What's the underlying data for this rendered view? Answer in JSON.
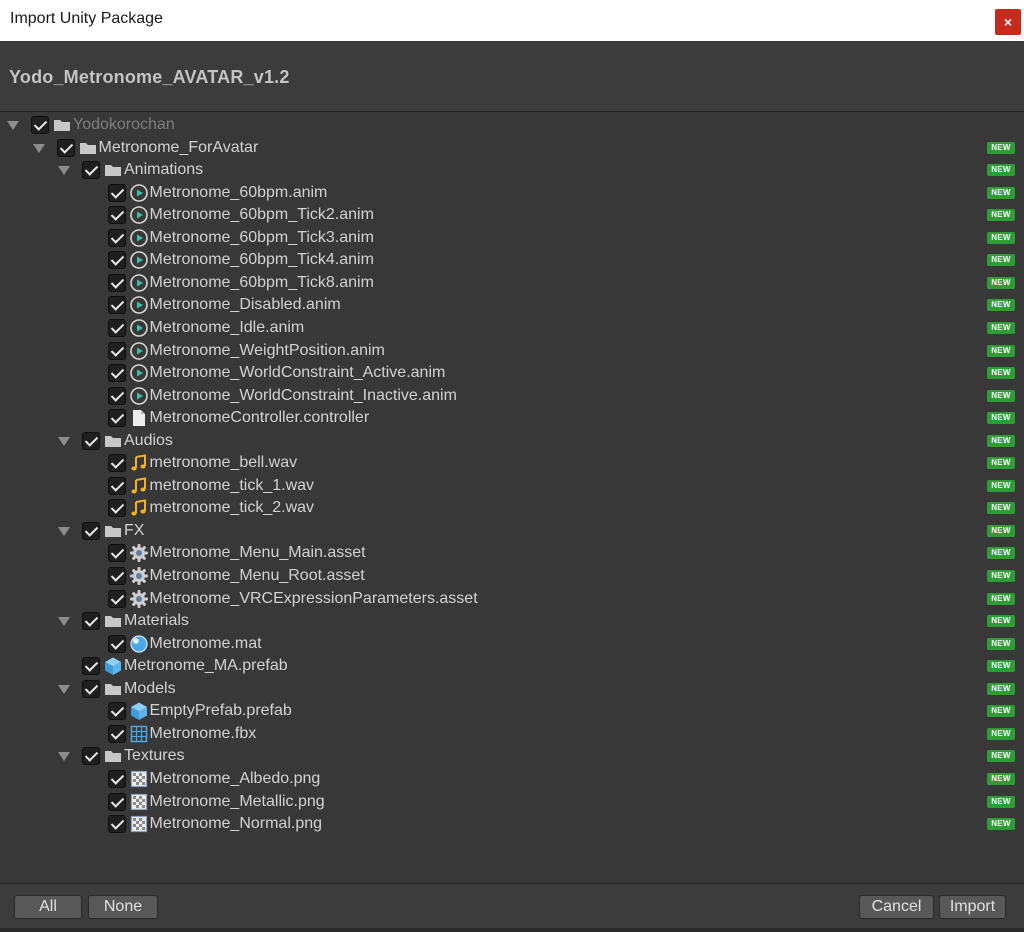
{
  "window": {
    "title": "Import Unity Package",
    "close_glyph": "×"
  },
  "package": {
    "name": "Yodo_Metronome_AVATAR_v1.2"
  },
  "badge_text": "NEW",
  "rows": [
    {
      "label": "Yodokorochan",
      "icon": "folder-icon",
      "depth": 0,
      "expandable": true,
      "dim": true,
      "new": false
    },
    {
      "label": "Metronome_ForAvatar",
      "icon": "folder-icon",
      "depth": 1,
      "expandable": true,
      "new": true
    },
    {
      "label": "Animations",
      "icon": "folder-icon",
      "depth": 2,
      "expandable": true,
      "new": true
    },
    {
      "label": "Metronome_60bpm.anim",
      "icon": "animation-clip-icon",
      "depth": 3,
      "new": true
    },
    {
      "label": "Metronome_60bpm_Tick2.anim",
      "icon": "animation-clip-icon",
      "depth": 3,
      "new": true
    },
    {
      "label": "Metronome_60bpm_Tick3.anim",
      "icon": "animation-clip-icon",
      "depth": 3,
      "new": true
    },
    {
      "label": "Metronome_60bpm_Tick4.anim",
      "icon": "animation-clip-icon",
      "depth": 3,
      "new": true
    },
    {
      "label": "Metronome_60bpm_Tick8.anim",
      "icon": "animation-clip-icon",
      "depth": 3,
      "new": true
    },
    {
      "label": "Metronome_Disabled.anim",
      "icon": "animation-clip-icon",
      "depth": 3,
      "new": true
    },
    {
      "label": "Metronome_Idle.anim",
      "icon": "animation-clip-icon",
      "depth": 3,
      "new": true
    },
    {
      "label": "Metronome_WeightPosition.anim",
      "icon": "animation-clip-icon",
      "depth": 3,
      "new": true
    },
    {
      "label": "Metronome_WorldConstraint_Active.anim",
      "icon": "animation-clip-icon",
      "depth": 3,
      "new": true
    },
    {
      "label": "Metronome_WorldConstraint_Inactive.anim",
      "icon": "animation-clip-icon",
      "depth": 3,
      "new": true
    },
    {
      "label": "MetronomeController.controller",
      "icon": "file-icon",
      "depth": 3,
      "new": true
    },
    {
      "label": "Audios",
      "icon": "folder-icon",
      "depth": 2,
      "expandable": true,
      "new": true
    },
    {
      "label": "metronome_bell.wav",
      "icon": "audio-clip-icon",
      "depth": 3,
      "new": true
    },
    {
      "label": "metronome_tick_1.wav",
      "icon": "audio-clip-icon",
      "depth": 3,
      "new": true
    },
    {
      "label": "metronome_tick_2.wav",
      "icon": "audio-clip-icon",
      "depth": 3,
      "new": true
    },
    {
      "label": "FX",
      "icon": "folder-icon",
      "depth": 2,
      "expandable": true,
      "new": true
    },
    {
      "label": "Metronome_Menu_Main.asset",
      "icon": "gear-icon",
      "depth": 3,
      "new": true
    },
    {
      "label": "Metronome_Menu_Root.asset",
      "icon": "gear-icon",
      "depth": 3,
      "new": true
    },
    {
      "label": "Metronome_VRCExpressionParameters.asset",
      "icon": "gear-icon",
      "depth": 3,
      "new": true
    },
    {
      "label": "Materials",
      "icon": "folder-icon",
      "depth": 2,
      "expandable": true,
      "new": true
    },
    {
      "label": "Metronome.mat",
      "icon": "material-sphere-icon",
      "depth": 3,
      "new": true
    },
    {
      "label": "Metronome_MA.prefab",
      "icon": "prefab-cube-icon",
      "depth": 2,
      "new": true
    },
    {
      "label": "Models",
      "icon": "folder-icon",
      "depth": 2,
      "expandable": true,
      "new": true
    },
    {
      "label": "EmptyPrefab.prefab",
      "icon": "prefab-cube-icon",
      "depth": 3,
      "new": true
    },
    {
      "label": "Metronome.fbx",
      "icon": "mesh-grid-icon",
      "depth": 3,
      "new": true
    },
    {
      "label": "Textures",
      "icon": "folder-icon",
      "depth": 2,
      "expandable": true,
      "new": true
    },
    {
      "label": "Metronome_Albedo.png",
      "icon": "texture-icon",
      "depth": 3,
      "new": true
    },
    {
      "label": "Metronome_Metallic.png",
      "icon": "texture-icon",
      "depth": 3,
      "new": true
    },
    {
      "label": "Metronome_Normal.png",
      "icon": "texture-icon",
      "depth": 3,
      "new": true
    }
  ],
  "footer": {
    "all_label": "All",
    "none_label": "None",
    "cancel_label": "Cancel",
    "import_label": "Import"
  },
  "colors": {
    "background": "#383838",
    "badge_green": "#2e9d38",
    "close_red": "#c42b1c",
    "text": "#d2d2d2"
  }
}
